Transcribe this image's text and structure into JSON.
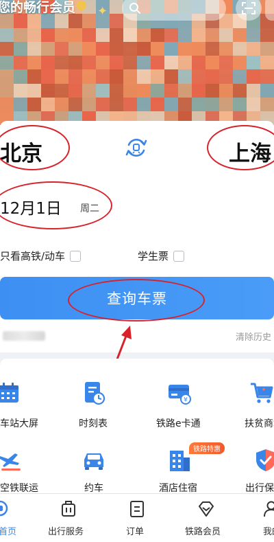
{
  "banner": {
    "title": "您的畅行会员",
    "search_placeholder": ""
  },
  "trip": {
    "from_city": "北京",
    "to_city": "上海",
    "date": "12月1日",
    "weekday": "周二"
  },
  "options": {
    "high_speed_only": "只看高铁/动车",
    "student_ticket": "学生票"
  },
  "search_button": "查询车票",
  "clear_history": "清除历史",
  "services": {
    "row1": [
      "车站大屏",
      "时刻表",
      "铁路e卡通",
      "扶贫商城"
    ],
    "row2": [
      "空铁联运",
      "约车",
      "酒店住宿",
      "出行保险"
    ],
    "badge": "铁路特惠"
  },
  "tabs": [
    {
      "label": "首页",
      "active": true
    },
    {
      "label": "出行服务",
      "active": false
    },
    {
      "label": "订单",
      "active": false
    },
    {
      "label": "铁路会员",
      "active": false
    },
    {
      "label": "我的",
      "active": false
    }
  ],
  "colors": {
    "accent": "#3a86e8",
    "button": "#4496f5",
    "annotation": "#d8222a"
  }
}
